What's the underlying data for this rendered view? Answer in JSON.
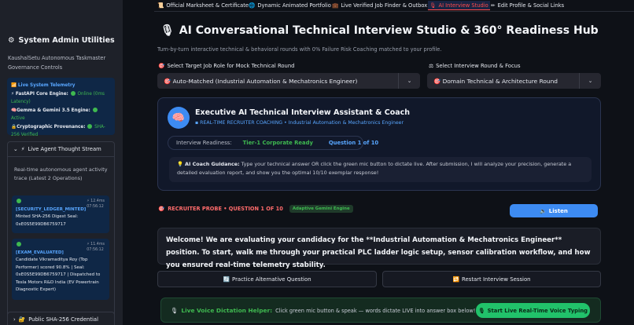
{
  "sidebar": {
    "title": "System Admin Utilities",
    "title_icon": "gear-icon",
    "subtitle": "KaushalSetu Autonomous Taskmaster Governance Controls",
    "telemetry": {
      "heading": "Live System Telemetry",
      "line1_label": "FastAPI Core Engine:",
      "line1_value": "Online (0ms Latency)",
      "line2_label": "Gemma & Gemini 3.5 Engine:",
      "line2_value": "Active",
      "line3_label": "Cryptographic Provenance:",
      "line3_value": "SHA-256 Verified"
    },
    "thought_stream": {
      "header": "Live Agent Thought Stream",
      "description": "Real-time autonomous agent activity trace (Latest 2 Operations)",
      "logs": [
        {
          "tag": "[SECURITY_LEDGER_MINTED]",
          "meta_time": "12.4ms",
          "meta_clock": "07:56:12",
          "text": "Minted SHA-256 Digest Seal: 0xE0S5E99DB6759717"
        },
        {
          "tag": "[EXAM_EVALUATED]",
          "meta_time": "11.4ms",
          "meta_clock": "07:56:12",
          "text": "Candidate Vikramaditya Roy (Top Performer) scored 90.8% | Seal: 0xE0S5E99DB6759717 | Dispatched to Tesla Motors R&D India (EV Powertrain Diagnostic Expert)"
        }
      ]
    },
    "credential_header": "Public SHA-256 Credential"
  },
  "tabs": [
    {
      "label": "Official Marksheet & Certificate",
      "icon": "scroll-icon"
    },
    {
      "label": "Dynamic Animated Portfolio",
      "icon": "globe-icon"
    },
    {
      "label": "Live Verified Job Finder & Outbox",
      "icon": "briefcase-icon"
    },
    {
      "label": "AI Interview Studio",
      "icon": "microphone-icon",
      "active": true
    },
    {
      "label": "Edit Profile & Social Links",
      "icon": "pencil-icon"
    }
  ],
  "main": {
    "title": "AI Conversational Technical Interview Studio & 360° Readiness Hub",
    "caption": "Turn-by-turn interactive technical & behavioral rounds with 0% Failure Risk Coaching matched to your profile.",
    "job_role": {
      "label": "Select Target Job Role for Mock Technical Round",
      "value": "Auto-Matched (Industrial Automation & Mechatronics Engineer)"
    },
    "round": {
      "label": "Select Interview Round & Focus",
      "value": "Domain Technical & Architecture Round"
    },
    "coach": {
      "title": "Executive AI Technical Interview Assistant & Coach",
      "subtitle": "REAL-TIME RECRUITER COACHING • Industrial Automation & Mechatronics Engineer",
      "readiness_label": "Interview Readiness:",
      "readiness_value": "Tier-1 Corporate Ready",
      "question_count": "Question 1 of 10",
      "guidance_label": "AI Coach Guidance:",
      "guidance_text": "Type your technical answer OR click the green mic button to dictate live. After submission, I will analyze your precision, generate a detailed evaluation report, and show you the optimal 10/10 exemplar response!"
    },
    "probe_label": "RECRUITER PROBE • QUESTION 1 OF 10",
    "probe_badge": "Adaptive Gemini Engine",
    "listen_button": "Listen",
    "question_text": "Welcome! We are evaluating your candidacy for the **Industrial Automation & Mechatronics Engineer** position. To start, walk me through your practical PLC ladder logic setup, sensor calibration workflow, and how you ensured real-time telemetry stability.",
    "practice_button": "Practice Alternative Question",
    "restart_button": "Restart Interview Session",
    "dictation": {
      "label": "Live Voice Dictation Helper:",
      "text": "Click green mic button & speak — words dictate LIVE into answer box below!",
      "button": "Start Live Real-Time Voice Typing"
    }
  },
  "colors": {
    "accent_red": "#ff4b4b",
    "accent_blue": "#3d8bf2",
    "accent_green": "#21c26a"
  }
}
